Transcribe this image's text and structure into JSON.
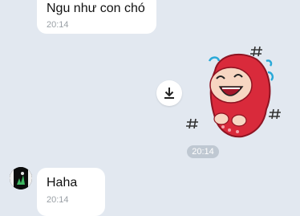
{
  "messages": {
    "top": {
      "text": "Ngu như con chó",
      "time": "20:14"
    },
    "sticker": {
      "time": "20:14",
      "icon": "laughing-girl-sticker"
    },
    "bottom": {
      "text": "Haha",
      "time": "20:14"
    }
  },
  "icons": {
    "download": "download-icon",
    "avatar": "contact-avatar"
  },
  "colors": {
    "background": "#e2e8f0",
    "bubble": "#ffffff",
    "time_pill": "#bfc8d2",
    "sticker_red": "#d92a3b"
  }
}
